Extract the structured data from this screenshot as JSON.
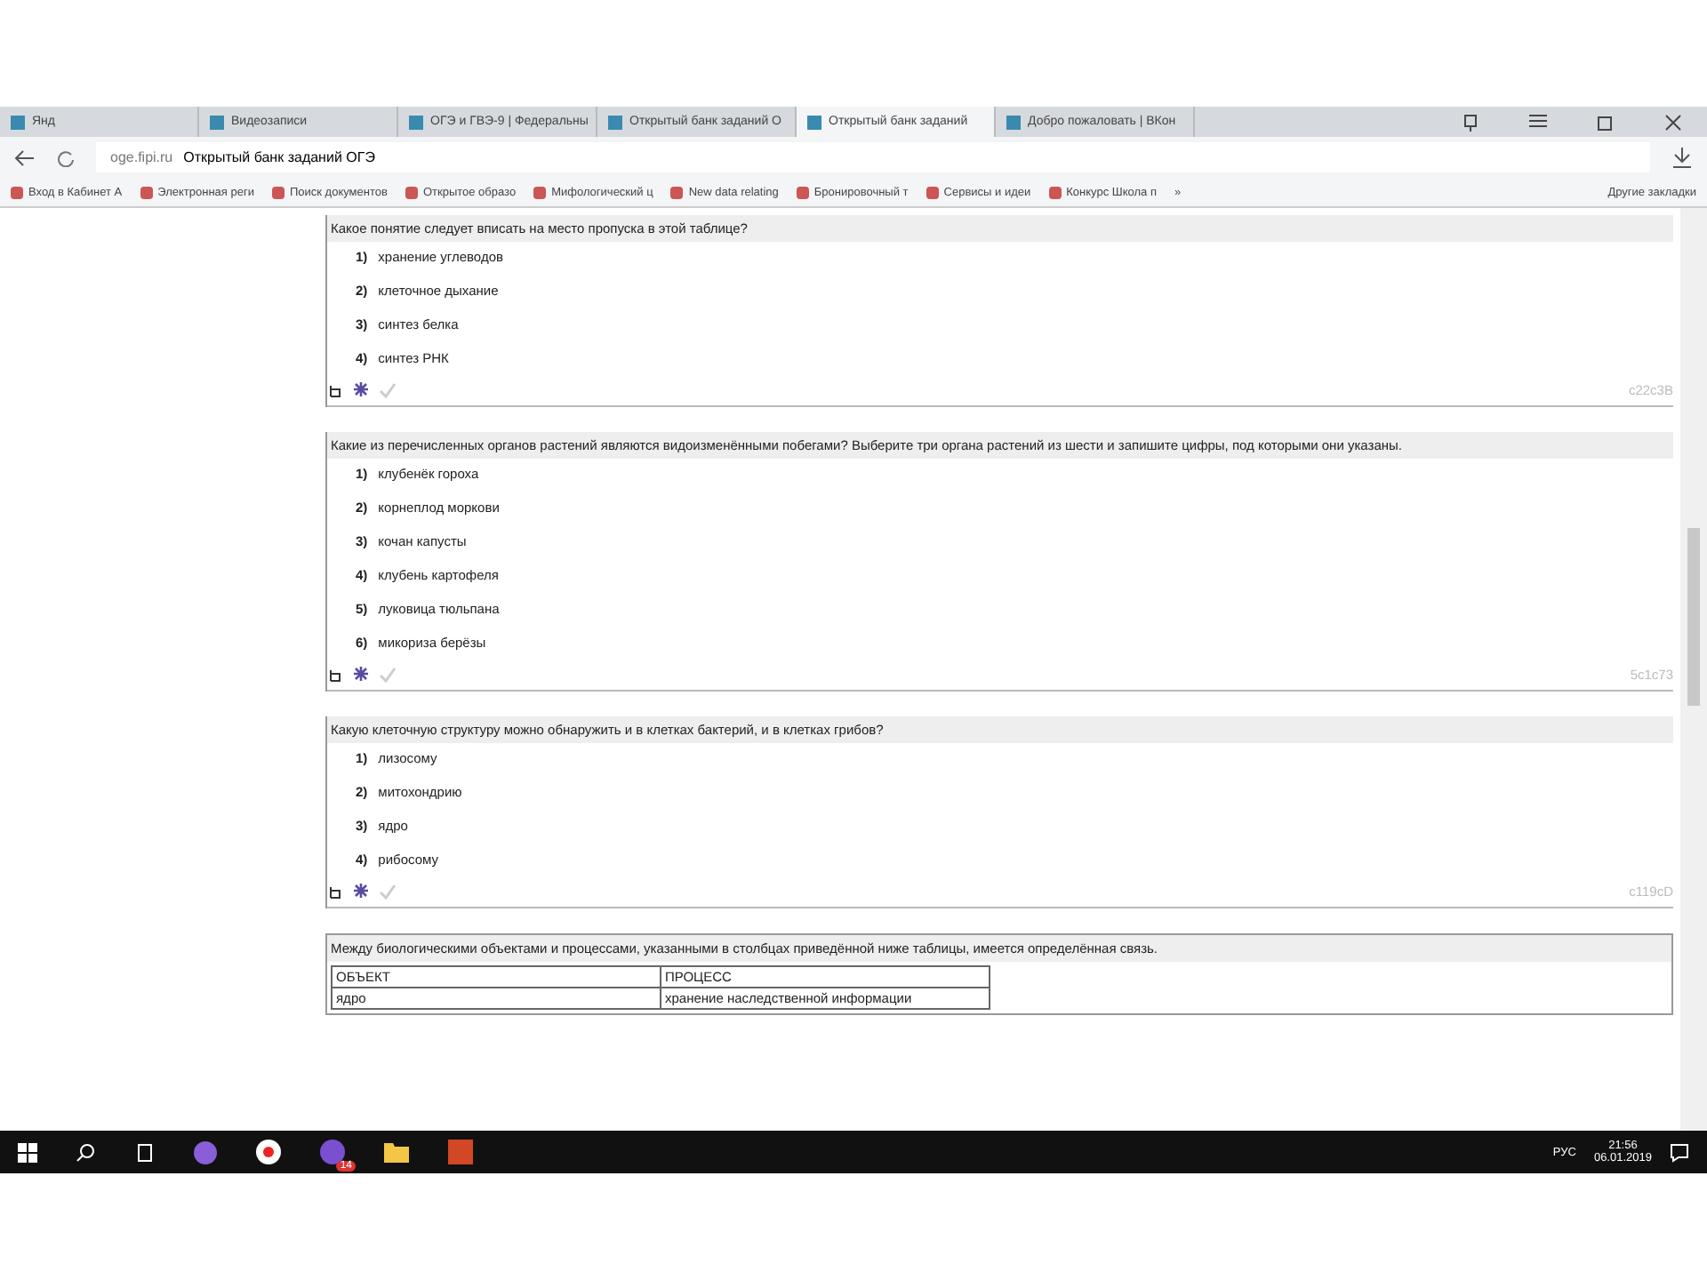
{
  "tabs": [
    {
      "label": "Янд",
      "selected": false
    },
    {
      "label": "Видеозаписи",
      "selected": false
    },
    {
      "label": "ОГЭ и ГВЭ-9 | Федеральны",
      "selected": false
    },
    {
      "label": "Открытый банк заданий О",
      "selected": false
    },
    {
      "label": "Открытый банк заданий",
      "selected": true
    },
    {
      "label": "Добро пожаловать | ВКон",
      "selected": false
    }
  ],
  "address": {
    "domain": "oge.fipi.ru",
    "title": "Открытый банк заданий ОГЭ"
  },
  "bookmarks": [
    "Вход в Кабинет А",
    "Электронная реги",
    "Поиск документов",
    "Открытое образо",
    "Мифологический ц",
    "New data relating",
    "Бронировочный т",
    "Сервисы и идеи",
    "Конкурс Школа п"
  ],
  "bookmarks_more": "»",
  "other_bookmarks": "Другие закладки",
  "questions": [
    {
      "prompt": "Какое понятие следует вписать на место пропуска в этой таблице?",
      "options": [
        {
          "num": "1)",
          "text": "хранение углеводов"
        },
        {
          "num": "2)",
          "text": "клеточное дыхание"
        },
        {
          "num": "3)",
          "text": "синтез белка"
        },
        {
          "num": "4)",
          "text": "синтез РНК"
        }
      ],
      "code": "c22c3B"
    },
    {
      "prompt": "Какие из перечисленных органов растений являются видоизменёнными побегами? Выберите три органа растений из шести и запишите цифры, под которыми они указаны.",
      "options": [
        {
          "num": "1)",
          "text": "клубенёк гороха"
        },
        {
          "num": "2)",
          "text": "корнеплод моркови"
        },
        {
          "num": "3)",
          "text": "кочан капусты"
        },
        {
          "num": "4)",
          "text": "клубень картофеля"
        },
        {
          "num": "5)",
          "text": "луковица тюльпана"
        },
        {
          "num": "6)",
          "text": "микориза берёзы"
        }
      ],
      "code": "5c1c73"
    },
    {
      "prompt": "Какую клеточную структуру можно обнаружить и в клетках бактерий, и в клетках грибов?",
      "options": [
        {
          "num": "1)",
          "text": "лизосому"
        },
        {
          "num": "2)",
          "text": "митохондрию"
        },
        {
          "num": "3)",
          "text": "ядро"
        },
        {
          "num": "4)",
          "text": "рибосому"
        }
      ],
      "code": "c119cD"
    }
  ],
  "last_question": {
    "prompt": "Между биологическими объектами и процессами, указанными в столбцах приведённой ниже таблицы, имеется определённая связь.",
    "table": {
      "columns": [
        "ОБЪЕКТ",
        "ПРОЦЕСС"
      ],
      "rows": [
        [
          "ядро",
          "хранение наследственной информации"
        ]
      ]
    }
  },
  "taskbar": {
    "badge": "14",
    "lang": "РУС",
    "time": "21:56",
    "date": "06.01.2019"
  }
}
